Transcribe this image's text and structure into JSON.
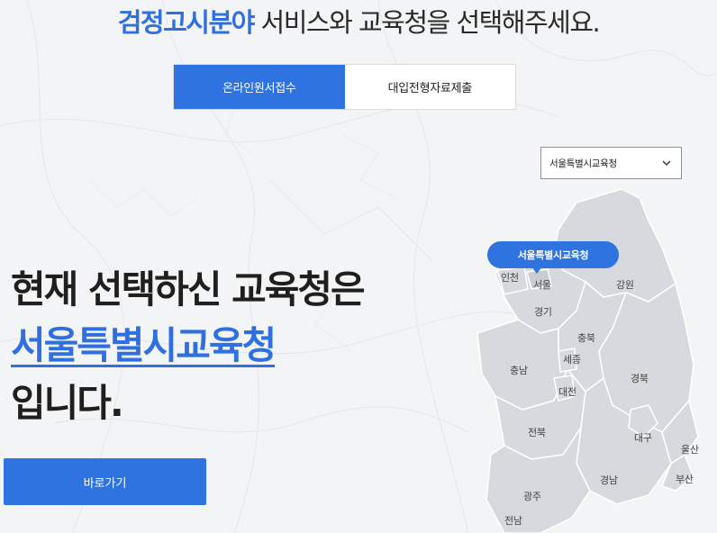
{
  "headline": {
    "highlight": "검정고시분야",
    "rest": " 서비스와 교육청을 선택해주세요."
  },
  "tabs": [
    {
      "label": "온라인원서접수",
      "active": true
    },
    {
      "label": "대입전형자료제출",
      "active": false
    }
  ],
  "office_select": {
    "value": "서울특별시교육청",
    "icon": "chevron-down-icon"
  },
  "main": {
    "line1": "현재 선택하신 교육청은",
    "line2": "서울특별시교육청",
    "line3": "입니다."
  },
  "go_button": {
    "label": "바로가기"
  },
  "map": {
    "selected_label": "서울특별시교육청",
    "regions": [
      "인천",
      "서울",
      "강원",
      "경기",
      "충북",
      "세종",
      "충남",
      "경북",
      "대전",
      "전북",
      "대구",
      "울산",
      "부산",
      "경남",
      "광주",
      "전남"
    ]
  },
  "colors": {
    "accent": "#2f73e0",
    "map_fill": "#d6d9dd",
    "background": "#f3f4f5"
  }
}
